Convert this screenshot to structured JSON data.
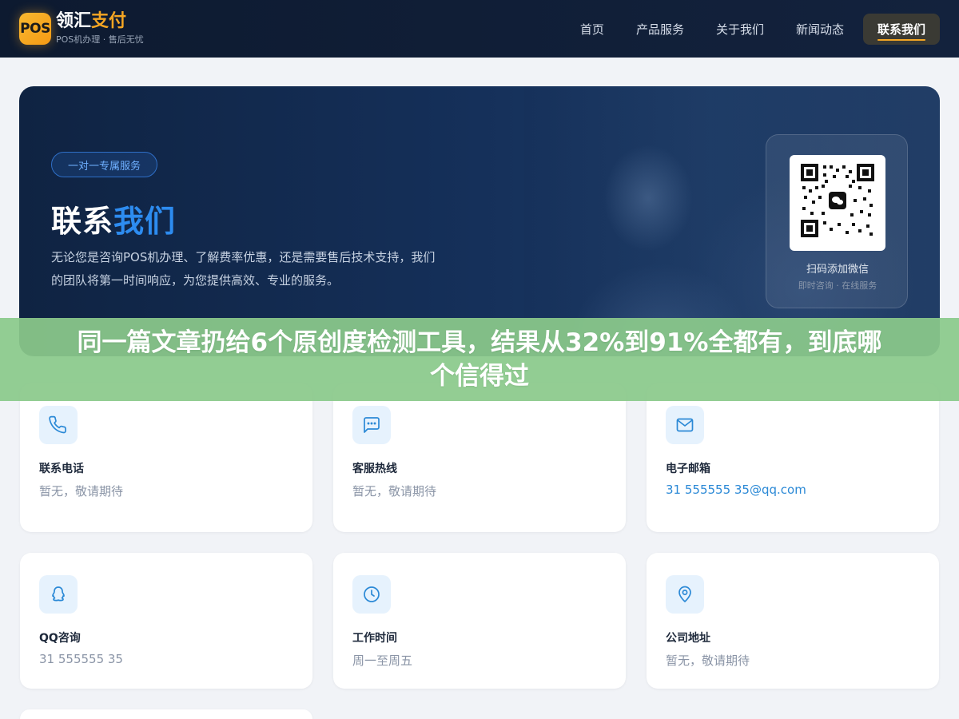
{
  "header": {
    "logo_badge": "POS",
    "logo_name_a": "领汇",
    "logo_name_b": "支付",
    "logo_sub": "POS机办理 · 售后无忧",
    "nav": [
      {
        "label": "首页"
      },
      {
        "label": "产品服务"
      },
      {
        "label": "关于我们"
      },
      {
        "label": "新闻动态"
      },
      {
        "label": "联系我们",
        "active": true
      }
    ]
  },
  "hero": {
    "pill": "一对一专属服务",
    "title_a": "联系",
    "title_b": "我们",
    "desc_line1": "无论您是咨询POS机办理、了解费率优惠，还是需要售后技术支持，我们",
    "desc_line2": "的团队将第一时间响应，为您提供高效、专业的服务。",
    "qr_title": "扫码添加微信",
    "qr_sub": "即时咨询 · 在线服务"
  },
  "banner": {
    "line1": "同一篇文章扔给6个原创度检测工具，结果从32%到91%全都有，到底哪",
    "line2": "个信得过"
  },
  "cards": [
    {
      "label": "联系电话",
      "value": "暂无，敬请期待",
      "icon": "phone-icon"
    },
    {
      "label": "客服热线",
      "value": "暂无，敬请期待",
      "icon": "chat-icon"
    },
    {
      "label": "电子邮箱",
      "value": "31 555555 35@qq.com",
      "icon": "mail-icon"
    },
    {
      "label": "QQ咨询",
      "value": "31 555555 35",
      "icon": "qq-icon"
    },
    {
      "label": "工作时间",
      "value": "周一至周五",
      "icon": "clock-icon"
    },
    {
      "label": "公司地址",
      "value": "暂无，敬请期待",
      "icon": "location-icon"
    }
  ],
  "colors": {
    "header_bg": "#0d1a30",
    "accent_orange": "#f5a623",
    "accent_blue": "#2d8cf0",
    "banner_green": "#8bc98b",
    "icon_bg": "#e6f2fd",
    "icon_stroke": "#2b89d6"
  }
}
